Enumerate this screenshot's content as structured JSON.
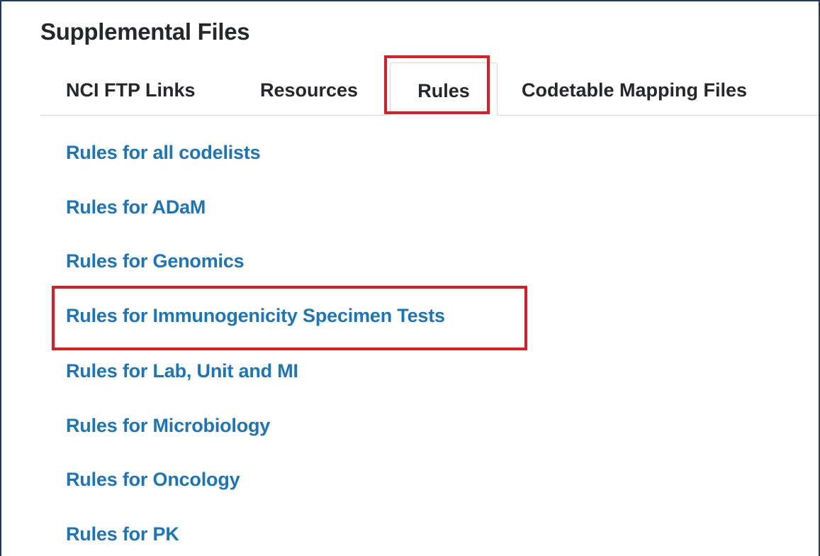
{
  "section": {
    "title": "Supplemental Files"
  },
  "tabs": [
    {
      "label": "NCI FTP Links"
    },
    {
      "label": "Resources"
    },
    {
      "label": "Rules"
    },
    {
      "label": "Codetable Mapping Files"
    }
  ],
  "active_tab": "Rules",
  "links": [
    {
      "label": "Rules for all codelists"
    },
    {
      "label": "Rules for ADaM"
    },
    {
      "label": "Rules for Genomics"
    },
    {
      "label": "Rules for Immunogenicity Specimen Tests"
    },
    {
      "label": "Rules for Lab, Unit and MI"
    },
    {
      "label": "Rules for Microbiology"
    },
    {
      "label": "Rules for Oncology"
    },
    {
      "label": "Rules for PK"
    }
  ],
  "colors": {
    "link": "#1b75bb",
    "text": "#25282b",
    "highlight": "#e01b22",
    "frame_border": "#1f3a5a"
  }
}
